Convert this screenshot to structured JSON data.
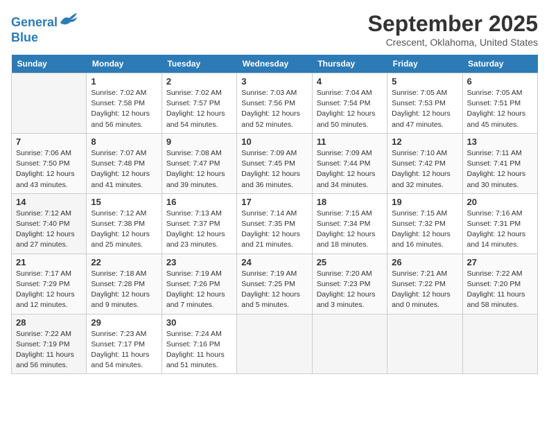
{
  "header": {
    "logo_line1": "General",
    "logo_line2": "Blue",
    "month": "September 2025",
    "location": "Crescent, Oklahoma, United States"
  },
  "weekdays": [
    "Sunday",
    "Monday",
    "Tuesday",
    "Wednesday",
    "Thursday",
    "Friday",
    "Saturday"
  ],
  "weeks": [
    [
      {
        "day": "",
        "info": ""
      },
      {
        "day": "1",
        "info": "Sunrise: 7:02 AM\nSunset: 7:58 PM\nDaylight: 12 hours\nand 56 minutes."
      },
      {
        "day": "2",
        "info": "Sunrise: 7:02 AM\nSunset: 7:57 PM\nDaylight: 12 hours\nand 54 minutes."
      },
      {
        "day": "3",
        "info": "Sunrise: 7:03 AM\nSunset: 7:56 PM\nDaylight: 12 hours\nand 52 minutes."
      },
      {
        "day": "4",
        "info": "Sunrise: 7:04 AM\nSunset: 7:54 PM\nDaylight: 12 hours\nand 50 minutes."
      },
      {
        "day": "5",
        "info": "Sunrise: 7:05 AM\nSunset: 7:53 PM\nDaylight: 12 hours\nand 47 minutes."
      },
      {
        "day": "6",
        "info": "Sunrise: 7:05 AM\nSunset: 7:51 PM\nDaylight: 12 hours\nand 45 minutes."
      }
    ],
    [
      {
        "day": "7",
        "info": "Sunrise: 7:06 AM\nSunset: 7:50 PM\nDaylight: 12 hours\nand 43 minutes."
      },
      {
        "day": "8",
        "info": "Sunrise: 7:07 AM\nSunset: 7:48 PM\nDaylight: 12 hours\nand 41 minutes."
      },
      {
        "day": "9",
        "info": "Sunrise: 7:08 AM\nSunset: 7:47 PM\nDaylight: 12 hours\nand 39 minutes."
      },
      {
        "day": "10",
        "info": "Sunrise: 7:09 AM\nSunset: 7:45 PM\nDaylight: 12 hours\nand 36 minutes."
      },
      {
        "day": "11",
        "info": "Sunrise: 7:09 AM\nSunset: 7:44 PM\nDaylight: 12 hours\nand 34 minutes."
      },
      {
        "day": "12",
        "info": "Sunrise: 7:10 AM\nSunset: 7:42 PM\nDaylight: 12 hours\nand 32 minutes."
      },
      {
        "day": "13",
        "info": "Sunrise: 7:11 AM\nSunset: 7:41 PM\nDaylight: 12 hours\nand 30 minutes."
      }
    ],
    [
      {
        "day": "14",
        "info": "Sunrise: 7:12 AM\nSunset: 7:40 PM\nDaylight: 12 hours\nand 27 minutes."
      },
      {
        "day": "15",
        "info": "Sunrise: 7:12 AM\nSunset: 7:38 PM\nDaylight: 12 hours\nand 25 minutes."
      },
      {
        "day": "16",
        "info": "Sunrise: 7:13 AM\nSunset: 7:37 PM\nDaylight: 12 hours\nand 23 minutes."
      },
      {
        "day": "17",
        "info": "Sunrise: 7:14 AM\nSunset: 7:35 PM\nDaylight: 12 hours\nand 21 minutes."
      },
      {
        "day": "18",
        "info": "Sunrise: 7:15 AM\nSunset: 7:34 PM\nDaylight: 12 hours\nand 18 minutes."
      },
      {
        "day": "19",
        "info": "Sunrise: 7:15 AM\nSunset: 7:32 PM\nDaylight: 12 hours\nand 16 minutes."
      },
      {
        "day": "20",
        "info": "Sunrise: 7:16 AM\nSunset: 7:31 PM\nDaylight: 12 hours\nand 14 minutes."
      }
    ],
    [
      {
        "day": "21",
        "info": "Sunrise: 7:17 AM\nSunset: 7:29 PM\nDaylight: 12 hours\nand 12 minutes."
      },
      {
        "day": "22",
        "info": "Sunrise: 7:18 AM\nSunset: 7:28 PM\nDaylight: 12 hours\nand 9 minutes."
      },
      {
        "day": "23",
        "info": "Sunrise: 7:19 AM\nSunset: 7:26 PM\nDaylight: 12 hours\nand 7 minutes."
      },
      {
        "day": "24",
        "info": "Sunrise: 7:19 AM\nSunset: 7:25 PM\nDaylight: 12 hours\nand 5 minutes."
      },
      {
        "day": "25",
        "info": "Sunrise: 7:20 AM\nSunset: 7:23 PM\nDaylight: 12 hours\nand 3 minutes."
      },
      {
        "day": "26",
        "info": "Sunrise: 7:21 AM\nSunset: 7:22 PM\nDaylight: 12 hours\nand 0 minutes."
      },
      {
        "day": "27",
        "info": "Sunrise: 7:22 AM\nSunset: 7:20 PM\nDaylight: 11 hours\nand 58 minutes."
      }
    ],
    [
      {
        "day": "28",
        "info": "Sunrise: 7:22 AM\nSunset: 7:19 PM\nDaylight: 11 hours\nand 56 minutes."
      },
      {
        "day": "29",
        "info": "Sunrise: 7:23 AM\nSunset: 7:17 PM\nDaylight: 11 hours\nand 54 minutes."
      },
      {
        "day": "30",
        "info": "Sunrise: 7:24 AM\nSunset: 7:16 PM\nDaylight: 11 hours\nand 51 minutes."
      },
      {
        "day": "",
        "info": ""
      },
      {
        "day": "",
        "info": ""
      },
      {
        "day": "",
        "info": ""
      },
      {
        "day": "",
        "info": ""
      }
    ]
  ]
}
